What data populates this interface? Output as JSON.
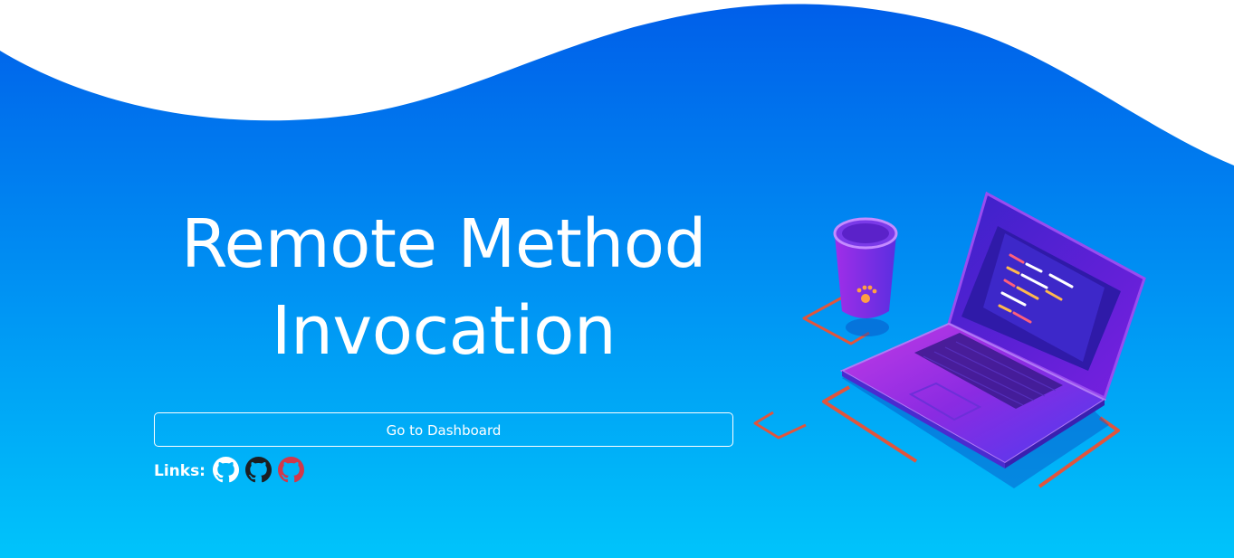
{
  "hero": {
    "title": "Remote Method Invocation"
  },
  "actions": {
    "dashboard_label": "Go to Dashboard"
  },
  "links": {
    "label": "Links:",
    "items": [
      {
        "icon": "github-icon",
        "color": "#ffffff"
      },
      {
        "icon": "github-icon",
        "color": "#1b1f23"
      },
      {
        "icon": "github-icon",
        "color": "#d2384b"
      }
    ]
  },
  "colors": {
    "gradient_top": "#005ee9",
    "gradient_bottom": "#00c4fb",
    "wave": "#ffffff",
    "laptop_accent": "#8a2be2",
    "cable_accent": "#e0553d"
  }
}
